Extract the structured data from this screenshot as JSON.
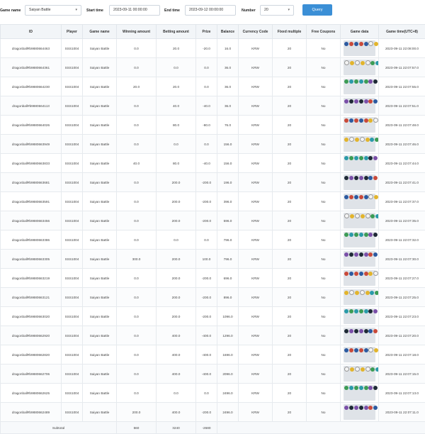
{
  "filters": {
    "game_name_label": "Game name",
    "game_name_value": "Saiyan Battle",
    "start_time_label": "Start time",
    "start_time_value": "2023-09-11 00:00:00",
    "end_time_label": "End time",
    "end_time_value": "2023-09-12 00:00:00",
    "number_label": "Number",
    "number_value": "20",
    "query_label": "Query"
  },
  "table": {
    "headers": [
      "ID",
      "Player",
      "Game name",
      "Winning amount",
      "Betting amount",
      "Prize",
      "Balance",
      "Currency Code",
      "Fixed multiple",
      "Free Coupons",
      "Game data",
      "Game time(UTC+8)"
    ],
    "rows": [
      [
        "dragonball#b9880664463",
        "SSS1004",
        "Saiyan Battle",
        "0.0",
        "20.0",
        "-20.0",
        "16.0",
        "KRW",
        "20",
        "No",
        "",
        "2023-09-11 22:08:00.0"
      ],
      [
        "dragonball#b9880664361",
        "SSS1004",
        "Saiyan Battle",
        "0.0",
        "0.0",
        "0.0",
        "36.0",
        "KRW",
        "20",
        "No",
        "",
        "2023-09-11 22:07:57.0"
      ],
      [
        "dragonball#b9880664230",
        "SSS1004",
        "Saiyan Battle",
        "20.0",
        "20.0",
        "0.0",
        "36.0",
        "KRW",
        "20",
        "No",
        "",
        "2023-09-11 22:07:55.0"
      ],
      [
        "dragonball#b9880664113",
        "SSS1004",
        "Saiyan Battle",
        "0.0",
        "40.0",
        "-40.0",
        "36.0",
        "KRW",
        "20",
        "No",
        "",
        "2023-09-11 22:07:51.0"
      ],
      [
        "dragonball#b9880664026",
        "SSS1004",
        "Saiyan Battle",
        "0.0",
        "80.0",
        "-80.0",
        "76.0",
        "KRW",
        "20",
        "No",
        "",
        "2023-09-11 22:07:48.0"
      ],
      [
        "dragonball#b9880663949",
        "SSS1004",
        "Saiyan Battle",
        "0.0",
        "0.0",
        "0.0",
        "156.0",
        "KRW",
        "20",
        "No",
        "",
        "2023-09-11 22:07:46.0"
      ],
      [
        "dragonball#b9880663833",
        "SSS1004",
        "Saiyan Battle",
        "40.0",
        "80.0",
        "-40.0",
        "156.0",
        "KRW",
        "20",
        "No",
        "",
        "2023-09-11 22:07:44.0"
      ],
      [
        "dragonball#b9880663681",
        "SSS1004",
        "Saiyan Battle",
        "0.0",
        "200.0",
        "-200.0",
        "196.0",
        "KRW",
        "20",
        "No",
        "",
        "2023-09-11 22:07:41.0"
      ],
      [
        "dragonball#b9880663591",
        "SSS1004",
        "Saiyan Battle",
        "0.0",
        "200.0",
        "-200.0",
        "396.0",
        "KRW",
        "20",
        "No",
        "",
        "2023-09-11 22:07:37.0"
      ],
      [
        "dragonball#b9880663456",
        "SSS1004",
        "Saiyan Battle",
        "0.0",
        "200.0",
        "-200.0",
        "596.0",
        "KRW",
        "20",
        "No",
        "",
        "2023-09-11 22:07:35.0"
      ],
      [
        "dragonball#b9880663386",
        "SSS1004",
        "Saiyan Battle",
        "0.0",
        "0.0",
        "0.0",
        "796.0",
        "KRW",
        "20",
        "No",
        "",
        "2023-09-11 22:07:32.0"
      ],
      [
        "dragonball#b9880663305",
        "SSS1004",
        "Saiyan Battle",
        "300.0",
        "200.0",
        "100.0",
        "796.0",
        "KRW",
        "20",
        "No",
        "",
        "2023-09-11 22:07:30.0"
      ],
      [
        "dragonball#b9880663219",
        "SSS1004",
        "Saiyan Battle",
        "0.0",
        "200.0",
        "-200.0",
        "696.0",
        "KRW",
        "20",
        "No",
        "",
        "2023-09-11 22:07:27.0"
      ],
      [
        "dragonball#b9880663121",
        "SSS1004",
        "Saiyan Battle",
        "0.0",
        "200.0",
        "-200.0",
        "896.0",
        "KRW",
        "20",
        "No",
        "",
        "2023-09-11 22:07:25.0"
      ],
      [
        "dragonball#b9880663020",
        "SSS1004",
        "Saiyan Battle",
        "0.0",
        "200.0",
        "-200.0",
        "1096.0",
        "KRW",
        "20",
        "No",
        "",
        "2023-09-11 22:07:23.0"
      ],
      [
        "dragonball#b9880662920",
        "SSS1004",
        "Saiyan Battle",
        "0.0",
        "400.0",
        "-400.0",
        "1296.0",
        "KRW",
        "20",
        "No",
        "",
        "2023-09-11 22:07:20.0"
      ],
      [
        "dragonball#b9880662820",
        "SSS1004",
        "Saiyan Battle",
        "0.0",
        "400.0",
        "-400.0",
        "1696.0",
        "KRW",
        "20",
        "No",
        "",
        "2023-09-11 22:07:18.0"
      ],
      [
        "dragonball#b9880662706",
        "SSS1004",
        "Saiyan Battle",
        "0.0",
        "400.0",
        "-400.0",
        "2096.0",
        "KRW",
        "20",
        "No",
        "",
        "2023-09-11 22:07:15.0"
      ],
      [
        "dragonball#b9880662625",
        "SSS1004",
        "Saiyan Battle",
        "0.0",
        "0.0",
        "0.0",
        "2496.0",
        "KRW",
        "20",
        "No",
        "",
        "2023-09-11 22:07:13.0"
      ],
      [
        "dragonball#b9880662489",
        "SSS1004",
        "Saiyan Battle",
        "200.0",
        "400.0",
        "-200.0",
        "2496.0",
        "KRW",
        "20",
        "No",
        "",
        "2023-09-11 22:07:11.0"
      ]
    ],
    "subtotal": {
      "label": "Subtotal",
      "winning": "560",
      "betting": "3240",
      "prize": "-2680"
    }
  },
  "icons": {
    "dropdown": "chevron-down-icon",
    "game_data": "gem-grid-icon"
  },
  "colors": {
    "accent": "#3b8fd6",
    "header_bg": "#f2f5f8",
    "game_data_bg": "#dfe3e8"
  }
}
